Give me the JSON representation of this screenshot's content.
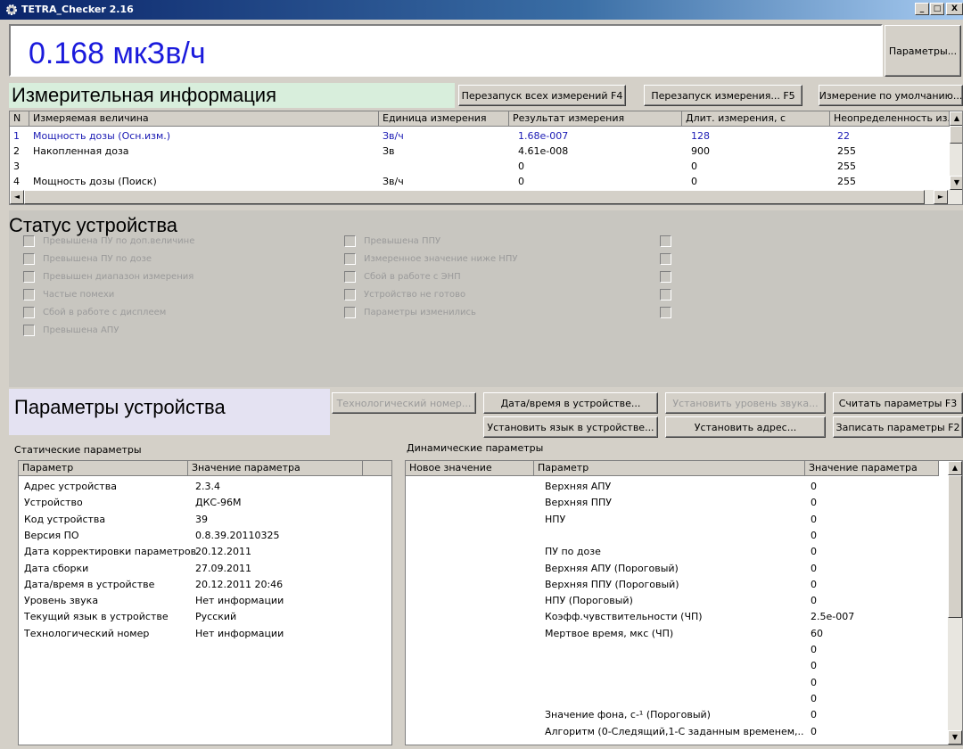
{
  "window": {
    "title": "TETRA_Checker 2.16",
    "min_label": "_",
    "max_label": "□",
    "close_label": "X"
  },
  "reading": {
    "value": "0.168 мкЗв/ч",
    "params_button": "Параметры..."
  },
  "measurement": {
    "title": "Измерительная информация",
    "buttons": [
      "Перезапуск всех измерений F4",
      "Перезапуск измерения... F5",
      "Измерение по умолчанию..."
    ],
    "columns": [
      "N",
      "Измеряемая величина",
      "Единица измерения",
      "Результат измерения",
      "Длит. измерения, с",
      "Неопределенность из..."
    ],
    "rows": [
      [
        "1",
        "Мощность дозы (Осн.изм.)",
        "Зв/ч",
        "1.68e-007",
        "128",
        "22"
      ],
      [
        "2",
        "Накопленная доза",
        "Зв",
        "4.61e-008",
        "900",
        "255"
      ],
      [
        "3",
        "",
        "",
        "0",
        "0",
        "255"
      ],
      [
        "4",
        "Мощность дозы (Поиск)",
        "Зв/ч",
        "0",
        "0",
        "255"
      ]
    ]
  },
  "status": {
    "title": "Статус устройства",
    "col1": [
      "Превышена ПУ по доп.величине",
      "Превышена ПУ по дозе",
      "Превышен диапазон измерения",
      "Частые помехи",
      "Сбой в работе с дисплеем",
      "Превышена АПУ"
    ],
    "col2": [
      "Превышена ППУ",
      "Измеренное значение ниже НПУ",
      "Сбой в работе с ЭНП",
      "Устройство не готово",
      "Параметры изменились"
    ],
    "col3": [
      "",
      "",
      "",
      "",
      ""
    ]
  },
  "device_params": {
    "title": "Параметры устройства",
    "buttons": {
      "tech_number": "Технологический номер...",
      "datetime": "Дата/время в устройстве...",
      "set_sound": "Установить уровень звука...",
      "read_params": "Считать параметры F3",
      "set_language": "Установить язык в устройстве...",
      "set_address": "Установить адрес...",
      "write_params": "Записать параметры F2"
    },
    "static": {
      "label": "Статические параметры",
      "columns": [
        "Параметр",
        "Значение параметра"
      ],
      "rows": [
        [
          "Адрес устройства",
          "2.3.4"
        ],
        [
          "Устройство",
          "ДКС-96М"
        ],
        [
          "Код устройства",
          "39"
        ],
        [
          "Версия ПО",
          "0.8.39.20110325"
        ],
        [
          "Дата корректировки параметров",
          "20.12.2011"
        ],
        [
          "Дата сборки",
          "27.09.2011"
        ],
        [
          "Дата/время в устройстве",
          "20.12.2011 20:46"
        ],
        [
          "Уровень звука",
          "Нет информации"
        ],
        [
          "Текущий язык в устройстве",
          "Русский"
        ],
        [
          "Технологический номер",
          "Нет информации"
        ]
      ]
    },
    "dynamic": {
      "label": "Динамические параметры",
      "columns": [
        "Новое значение",
        "Параметр",
        "Значение параметра"
      ],
      "rows": [
        [
          "",
          "Верхняя АПУ",
          "0"
        ],
        [
          "",
          "Верхняя ППУ",
          "0"
        ],
        [
          "",
          "НПУ",
          "0"
        ],
        [
          "",
          "",
          "0"
        ],
        [
          "",
          "ПУ по дозе",
          "0"
        ],
        [
          "",
          "Верхняя АПУ (Пороговый)",
          "0"
        ],
        [
          "",
          "Верхняя ППУ (Пороговый)",
          "0"
        ],
        [
          "",
          "НПУ (Пороговый)",
          "0"
        ],
        [
          "",
          "Коэфф.чувствительности (ЧП)",
          "2.5e-007"
        ],
        [
          "",
          "Мертвое время, мкс (ЧП)",
          "60"
        ],
        [
          "",
          "",
          "0"
        ],
        [
          "",
          "",
          "0"
        ],
        [
          "",
          "",
          "0"
        ],
        [
          "",
          "",
          "0"
        ],
        [
          "",
          "Значение фона, с-¹ (Пороговый)",
          "0"
        ],
        [
          "",
          "Алгоритм (0-Следящий,1-С заданным временем,...",
          "0"
        ]
      ]
    }
  }
}
